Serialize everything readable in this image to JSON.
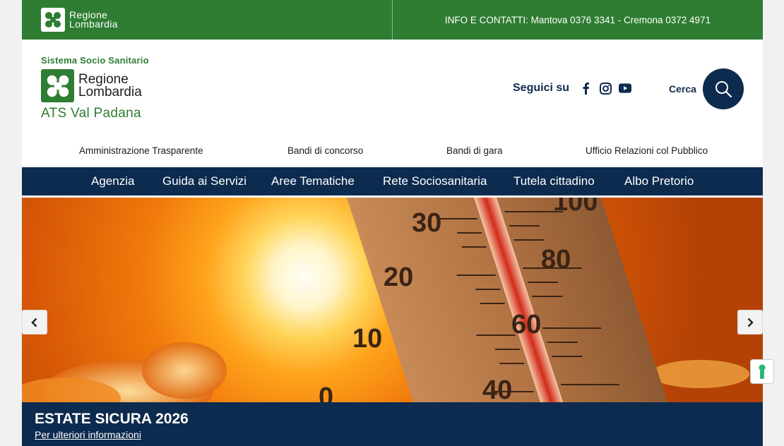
{
  "topbar": {
    "logo_line1": "Regione",
    "logo_line2": "Lombardia",
    "info": "INFO E CONTATTI: Mantova 0376 3341 - Cremona 0372 4971"
  },
  "brand": {
    "system": "Sistema Socio Sanitario",
    "line1": "Regione",
    "line2": "Lombardia",
    "ats": "ATS Val Padana"
  },
  "social": {
    "label": "Seguici su",
    "icons": [
      "facebook-icon",
      "instagram-icon",
      "youtube-icon"
    ]
  },
  "search": {
    "label": "Cerca",
    "icon": "search-icon"
  },
  "sublinks": [
    "Amministrazione Trasparente",
    "Bandi di concorso",
    "Bandi di gara",
    "Ufficio Relazioni col Pubblico"
  ],
  "nav": [
    "Agenzia",
    "Guida ai Servizi",
    "Aree Tematiche",
    "Rete Sociosanitaria",
    "Tutela cittadino",
    "Albo Pretorio"
  ],
  "hero": {
    "thermometer_left": [
      "30",
      "20",
      "10",
      "0"
    ],
    "thermometer_right": [
      "100",
      "80",
      "60",
      "40"
    ],
    "prev_icon": "chevron-left-icon",
    "next_icon": "chevron-right-icon"
  },
  "caption": {
    "title": "ESTATE SICURA 2026",
    "link": "Per ulteriori informazioni"
  },
  "colors": {
    "green": "#2e7d32",
    "navy": "#0d2b4e"
  }
}
